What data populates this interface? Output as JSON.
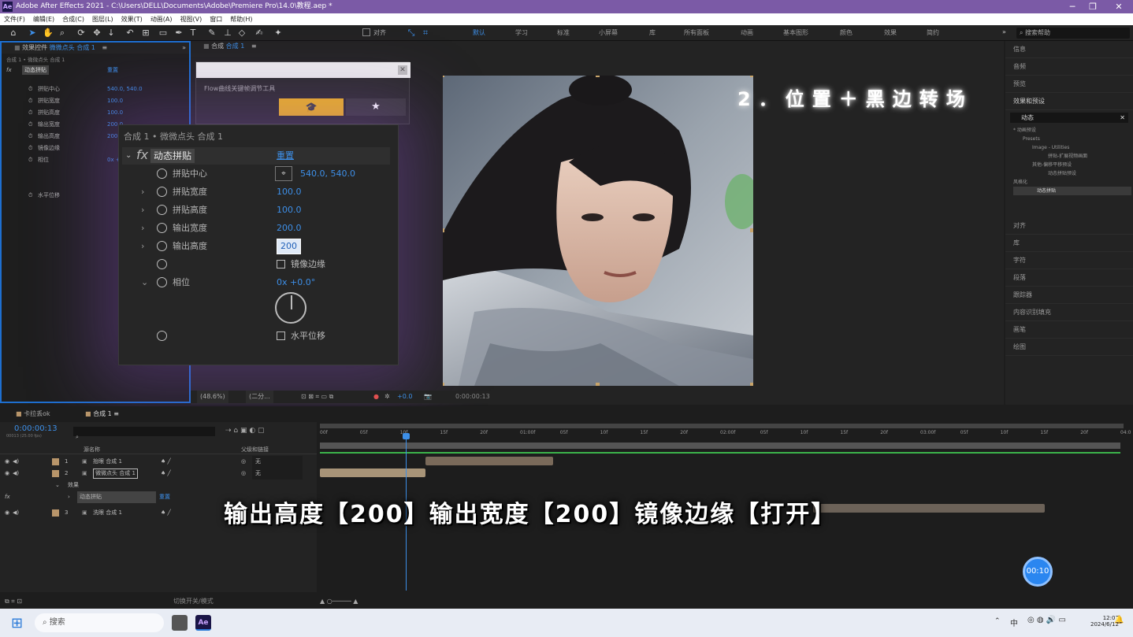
{
  "titlebar": {
    "logo": "Ae",
    "title": "Adobe After Effects 2021 - C:\\Users\\DELL\\Documents\\Adobe\\Premiere Pro\\14.0\\教程.aep *",
    "min": "─",
    "max": "❐",
    "close": "✕"
  },
  "menu": [
    "文件(F)",
    "编辑(E)",
    "合成(C)",
    "图层(L)",
    "效果(T)",
    "动画(A)",
    "视图(V)",
    "窗口",
    "帮助(H)"
  ],
  "toolbar": {
    "align_label": "对齐",
    "workspaces": [
      "默认",
      "学习",
      "标准",
      "小屏幕",
      "库",
      "所有面板",
      "动画",
      "基本图形",
      "颜色",
      "效果",
      "简约"
    ],
    "active_workspace": "默认",
    "search_help": "搜索帮助",
    "more": "»"
  },
  "effects_panel": {
    "tab": "效果控件",
    "tab_target": "微微点头 合成 1",
    "breadcrumb": "合成 1 • 微微点头 合成 1",
    "effect_name": "动态拼贴",
    "reset": "重置",
    "props": [
      {
        "label": "拼贴中心",
        "value": "540.0, 540.0"
      },
      {
        "label": "拼贴宽度",
        "value": "100.0"
      },
      {
        "label": "拼贴高度",
        "value": "100.0"
      },
      {
        "label": "输出宽度",
        "value": "200.0"
      },
      {
        "label": "输出高度",
        "value": "200.0"
      },
      {
        "label": "镜像边缘",
        "value": ""
      },
      {
        "label": "相位",
        "value": "0x +0.0°"
      },
      {
        "label": "水平位移",
        "value": ""
      }
    ]
  },
  "zoom": {
    "breadcrumb": "合成 1 • 微微点头 合成 1",
    "fx": "fx",
    "effect_name": "动态拼贴",
    "reset": "重置",
    "rows": [
      {
        "label": "拼贴中心",
        "value": "540.0, 540.0"
      },
      {
        "label": "拼贴宽度",
        "value": "100.0"
      },
      {
        "label": "拼贴高度",
        "value": "100.0"
      },
      {
        "label": "输出宽度",
        "value": "200.0"
      },
      {
        "label": "输出高度",
        "value": "200"
      },
      {
        "label": "镜像边缘",
        "value": ""
      },
      {
        "label": "相位",
        "value": "0x +0.0°"
      },
      {
        "label": "水平位移",
        "value": ""
      }
    ]
  },
  "viewer": {
    "tab": "合成",
    "tab_target": "合成 1",
    "flow_title": "Flow曲线关键帧调节工具",
    "zoom": "(48.6%)",
    "resolution": "(二分...",
    "timecode": "0:00:00:13",
    "plus": "+0.0"
  },
  "overlay_title": "2．位置＋黑边转场",
  "right_panel": {
    "items": [
      "信息",
      "音频",
      "预览",
      "效果和预设",
      "对齐",
      "库",
      "字符",
      "段落",
      "跟踪器",
      "内容识别填充",
      "画笔",
      "绘图"
    ],
    "search": "动态",
    "tree": [
      "* 动画预设",
      "Presets",
      "Image - Utilities",
      "拼贴-扩展视频画面",
      "其他-偏移平移预设",
      "动态拼贴预设",
      "风格化",
      "动态拼贴"
    ]
  },
  "timeline": {
    "tabs": [
      "卡拉丢ok",
      "合成 1"
    ],
    "timecode": "0:00:00:13",
    "frame_info": "00013 (25.00 fps)",
    "ruler": [
      "00f",
      "05f",
      "10f",
      "15f",
      "20f",
      "01:00f",
      "05f",
      "10f",
      "15f",
      "20f",
      "02:00f",
      "05f",
      "10f",
      "15f",
      "20f",
      "03:00f",
      "05f",
      "10f",
      "15f",
      "20f",
      "04:0"
    ],
    "headers": {
      "source": "源名称",
      "parent": "父级和链接"
    },
    "layers": [
      {
        "num": "1",
        "name": "抬眼 合成 1",
        "parent": "无"
      },
      {
        "num": "2",
        "name": "微微点头 合成 1",
        "parent": "无"
      },
      {
        "num": "3",
        "name": "洗眼 合成 1",
        "parent": "无"
      }
    ],
    "effects_label": "效果",
    "effect_row": "动态拼贴",
    "effect_reset": "重置",
    "footer": "切换开关/模式"
  },
  "subtitle": "输出高度【200】输出宽度【200】镜像边缘【打开】",
  "timer": "00:10",
  "taskbar": {
    "search": "搜索",
    "time": "12:07",
    "date": "2024/6/12",
    "lang": "中"
  }
}
